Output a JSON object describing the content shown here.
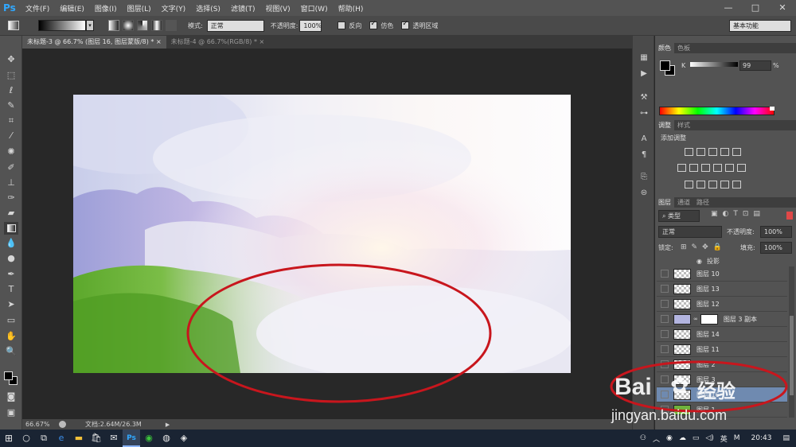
{
  "app": {
    "logo": "Ps"
  },
  "menu": [
    "文件(F)",
    "编辑(E)",
    "图像(I)",
    "图层(L)",
    "文字(Y)",
    "选择(S)",
    "滤镜(T)",
    "视图(V)",
    "窗口(W)",
    "帮助(H)"
  ],
  "window_controls": [
    "—",
    "□",
    "✕"
  ],
  "options": {
    "mode_label": "模式:",
    "mode_value": "正常",
    "opacity_label": "不透明度:",
    "opacity_value": "100%",
    "reverse_label": "反向",
    "dither_label": "仿色",
    "transparency_label": "透明区域",
    "workspace_value": "基本功能"
  },
  "tabs": [
    {
      "label": "未标题-3 @ 66.7% (图层 16, 图层蒙版/8) *",
      "close": "×"
    },
    {
      "label": "未标题-4 @ 66.7%(RGB/8) *",
      "close": "×"
    }
  ],
  "status": {
    "zoom": "66.67%",
    "doc": "文档:2.64M/26.3M"
  },
  "color_panel": {
    "tabs": [
      "颜色",
      "色板"
    ],
    "channel": "K",
    "value": "99",
    "unit": "%"
  },
  "adjust_panel": {
    "tabs": [
      "调整",
      "样式"
    ],
    "title": "添加调整"
  },
  "layers_panel": {
    "tabs": [
      "图层",
      "通道",
      "路径"
    ],
    "filter": "类型",
    "blend_mode": "正常",
    "opacity_label": "不透明度:",
    "opacity_value": "100%",
    "lock_label": "锁定:",
    "fill_label": "填充:",
    "fill_value": "100%",
    "effect_label": "投影",
    "layers": [
      {
        "name": "图层 10"
      },
      {
        "name": "图层 13"
      },
      {
        "name": "图层 12"
      },
      {
        "name": "图层 3 副本"
      },
      {
        "name": "图层 14"
      },
      {
        "name": "图层 11"
      },
      {
        "name": "图层 2"
      },
      {
        "name": "图层 3"
      },
      {
        "name": "图层 16"
      },
      {
        "name": "图层 1"
      }
    ]
  },
  "taskbar": {
    "time": "20:43",
    "ime": "英",
    "ime_mode": "M"
  },
  "watermark": {
    "brand": "Bai",
    "brand2": "经验",
    "url": "jingyan.baidu.com"
  },
  "colors": {
    "annotation_red": "#c8161d",
    "ps_blue": "#31a8ff"
  }
}
